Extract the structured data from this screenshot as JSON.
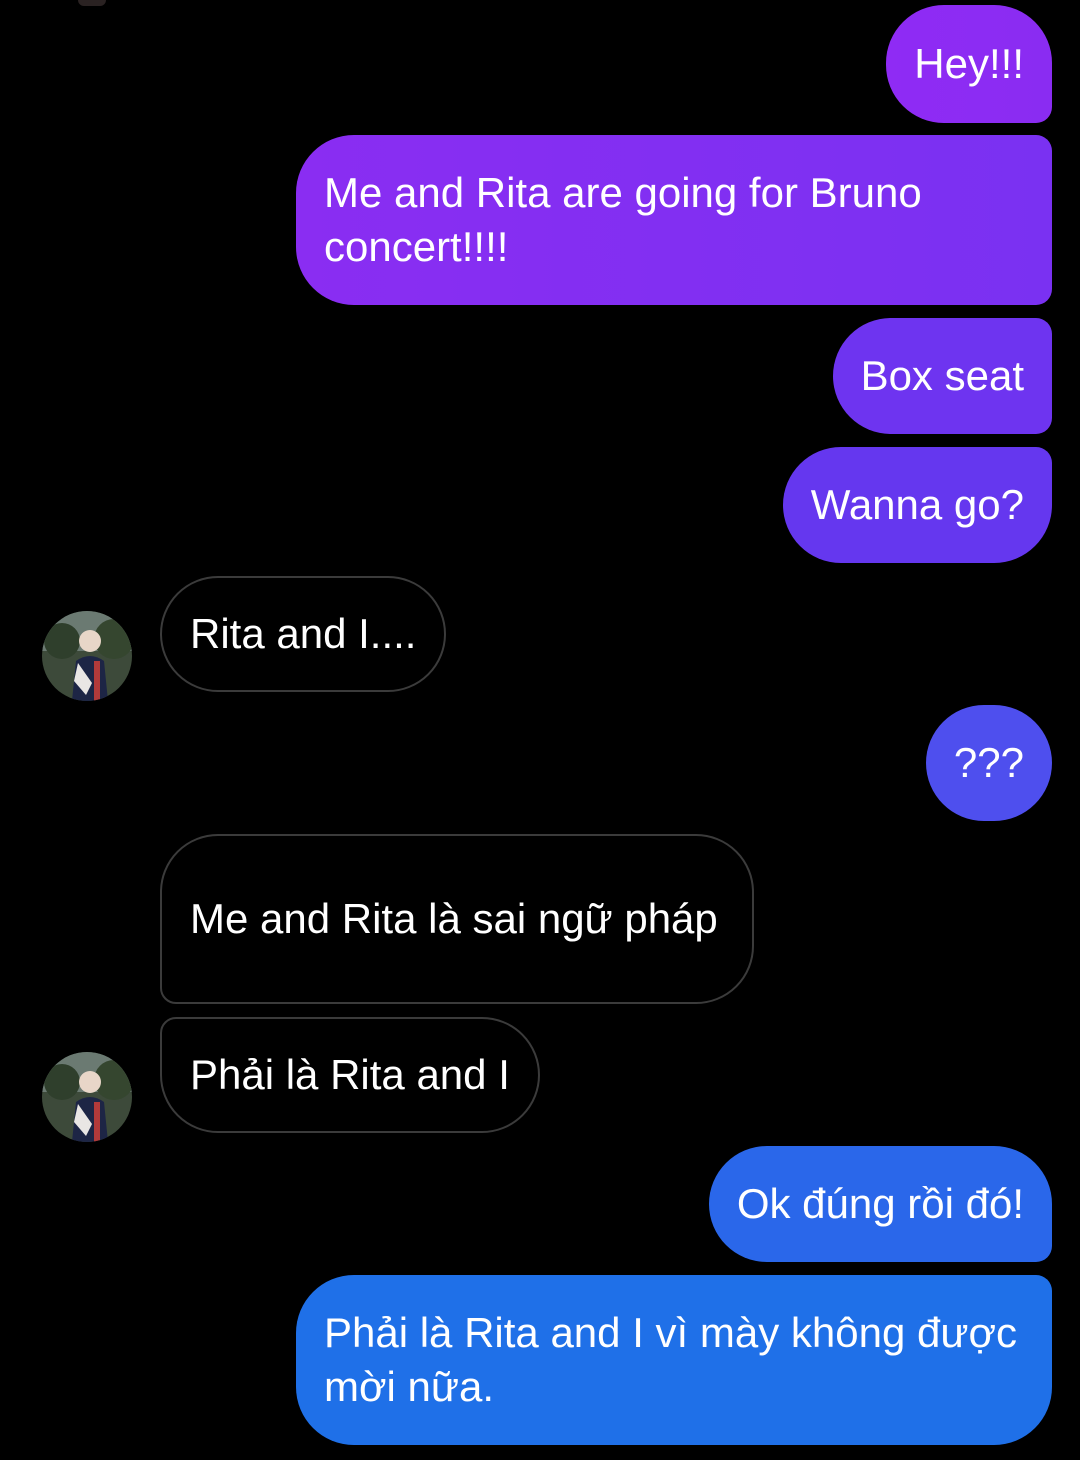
{
  "thread": {
    "messages": [
      {
        "sender": "me",
        "text": "Hey!!!"
      },
      {
        "sender": "me",
        "text": "Me and Rita are going for Bruno concert!!!!"
      },
      {
        "sender": "me",
        "text": "Box seat"
      },
      {
        "sender": "me",
        "text": "Wanna go?"
      },
      {
        "sender": "contact",
        "text": "Rita and I...."
      },
      {
        "sender": "me",
        "text": "???"
      },
      {
        "sender": "contact",
        "text": "Me and Rita là sai ngữ pháp"
      },
      {
        "sender": "contact",
        "text": "Phải là Rita and I"
      },
      {
        "sender": "me",
        "text": "Ok đúng rồi đó!"
      },
      {
        "sender": "me",
        "text": "Phải là Rita and I vì mày không được mời nữa."
      }
    ]
  },
  "colors": {
    "background": "#000000",
    "sent_purple": "#8b2cf3",
    "sent_violet": "#6a35f0",
    "sent_indigo": "#4f4fee",
    "sent_blue": "#1f6fe8",
    "received_border": "#3b3b3b"
  }
}
